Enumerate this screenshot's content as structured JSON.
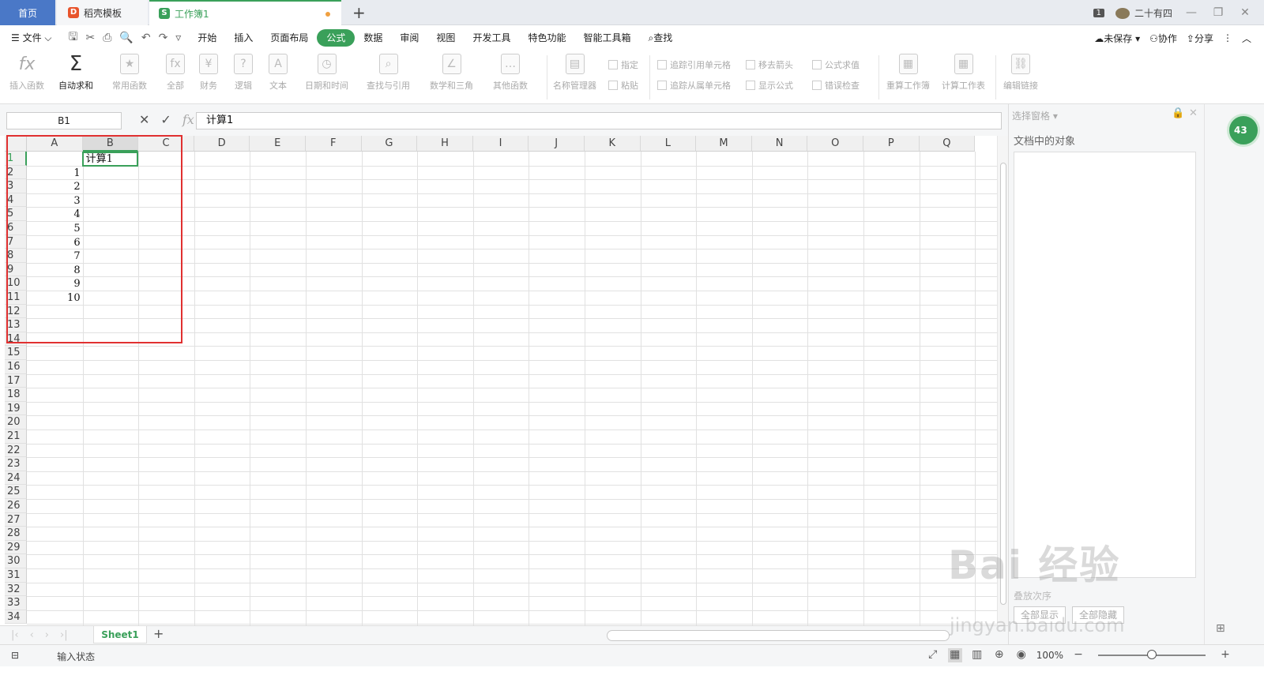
{
  "tabs": {
    "home": "首页",
    "template": "稻壳模板",
    "workbook": "工作簿1",
    "badge": "1",
    "user": "二十有四"
  },
  "menu": {
    "file": "文件",
    "items": [
      "开始",
      "插入",
      "页面布局",
      "公式",
      "数据",
      "审阅",
      "视图",
      "开发工具",
      "特色功能",
      "智能工具箱"
    ],
    "search": "查找",
    "unsaved": "未保存",
    "collab": "协作",
    "share": "分享"
  },
  "ribbon": {
    "insert_func": "插入函数",
    "autosum": "自动求和",
    "common": "常用函数",
    "all": "全部",
    "finance": "财务",
    "logic": "逻辑",
    "text": "文本",
    "datetime": "日期和时间",
    "lookup": "查找与引用",
    "math": "数学和三角",
    "other": "其他函数",
    "name_mgr": "名称管理器",
    "specify": "指定",
    "paste": "粘贴",
    "trace_pre": "追踪引用单元格",
    "trace_dep": "追踪从属单元格",
    "remove_arrows": "移去箭头",
    "show_formula": "显示公式",
    "eval": "公式求值",
    "err_check": "错误检查",
    "recalc_wb": "重算工作簿",
    "calc_sheet": "计算工作表",
    "edit_links": "编辑链接"
  },
  "formula": {
    "namebox": "B1",
    "fx": "fx",
    "value": "计算1"
  },
  "grid": {
    "columns": [
      "A",
      "B",
      "C",
      "D",
      "E",
      "F",
      "G",
      "H",
      "I",
      "J",
      "K",
      "L",
      "M",
      "N",
      "O",
      "P",
      "Q"
    ],
    "rows": [
      "1",
      "2",
      "3",
      "4",
      "5",
      "6",
      "7",
      "8",
      "9",
      "10",
      "11",
      "12",
      "13",
      "14",
      "15",
      "16",
      "17",
      "18",
      "19",
      "20",
      "21",
      "22",
      "23",
      "24",
      "25",
      "26",
      "27",
      "28",
      "29",
      "30",
      "31",
      "32",
      "33",
      "34"
    ],
    "b1": "计算1",
    "a_values": [
      "1",
      "2",
      "3",
      "4",
      "5",
      "6",
      "7",
      "8",
      "9",
      "10"
    ]
  },
  "sheet": {
    "name": "Sheet1"
  },
  "panel": {
    "title": "选择窗格",
    "label": "文档中的对象",
    "footer": "叠放次序",
    "show_all": "全部显示",
    "hide_all": "全部隐藏",
    "badge": "43"
  },
  "status": {
    "input": "输入状态",
    "zoom": "100%"
  },
  "watermark": {
    "brand": "Bai 经验",
    "url": "jingyan.baidu.com"
  }
}
